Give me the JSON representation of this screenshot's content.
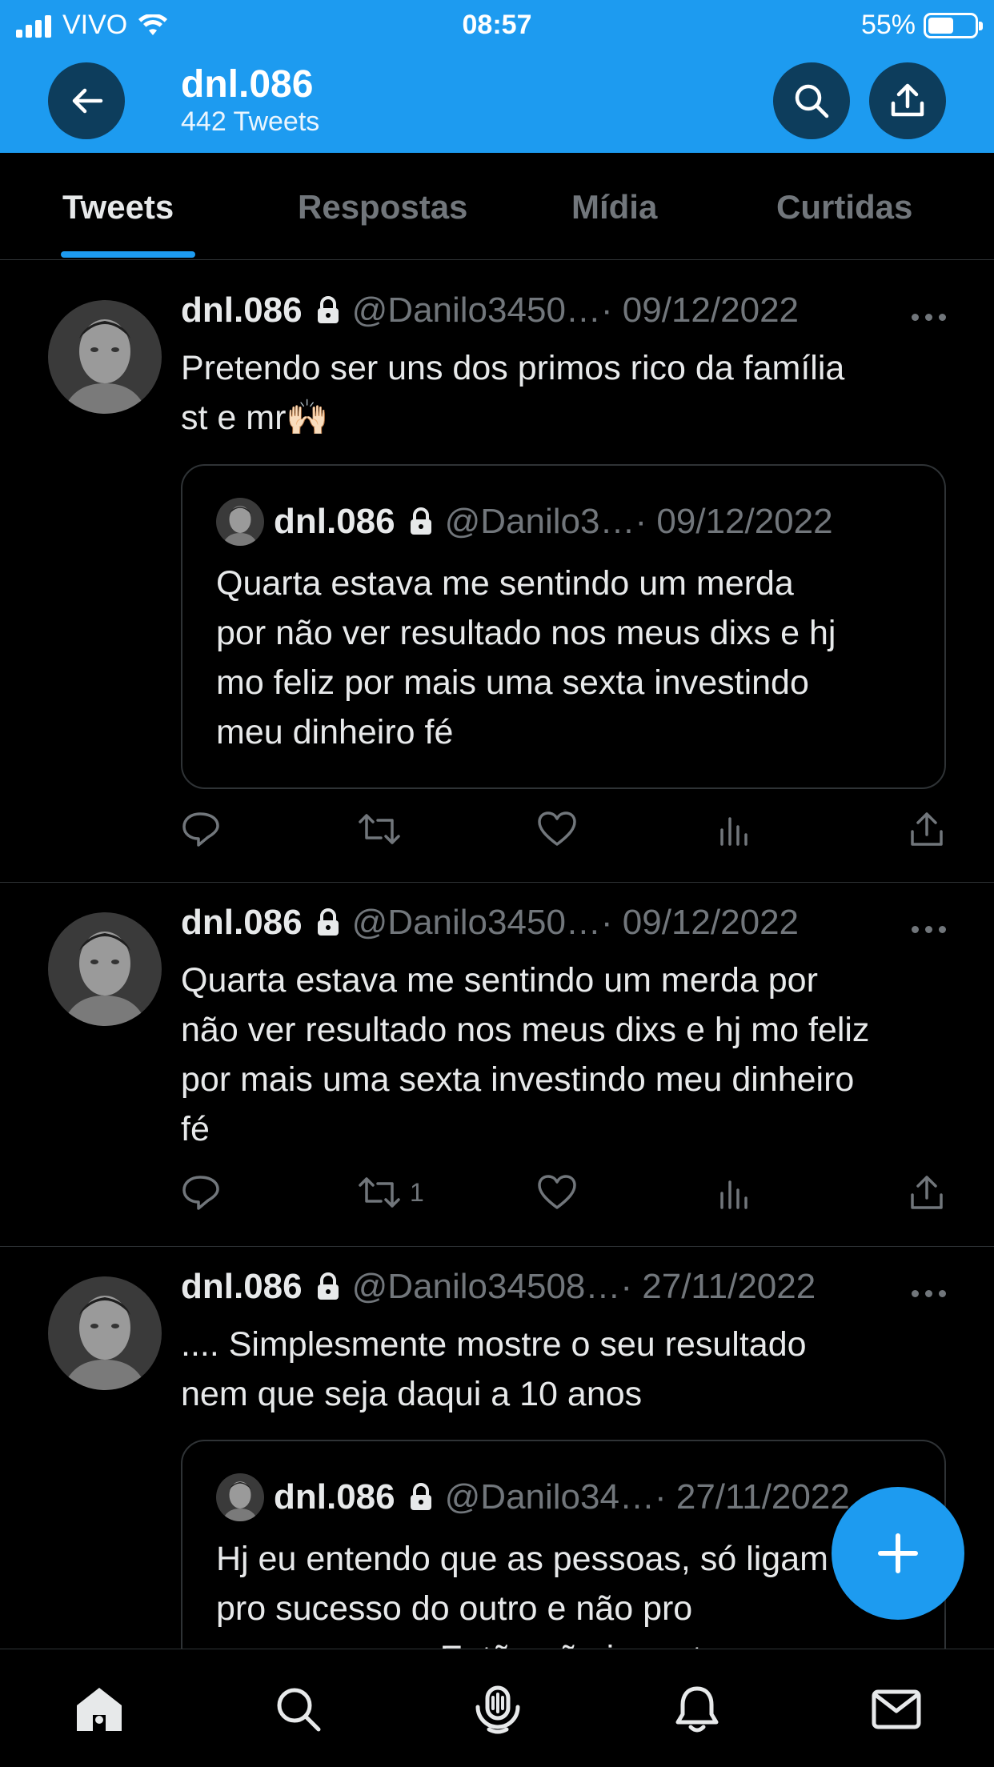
{
  "status_bar": {
    "carrier": "VIVO",
    "time": "08:57",
    "battery": "55%",
    "battery_level": 0.55
  },
  "header": {
    "title": "dnl.086",
    "subtitle": "442 Tweets"
  },
  "tabs": [
    {
      "label": "Tweets",
      "active": true
    },
    {
      "label": "Respostas",
      "active": false
    },
    {
      "label": "Mídia",
      "active": false
    },
    {
      "label": "Curtidas",
      "active": false
    }
  ],
  "tweets": [
    {
      "name": "dnl.086",
      "handle": "@Danilo3450…",
      "date": "· 09/12/2022",
      "text_lines": [
        "Pretendo ser uns dos primos rico da família",
        "st e mr🙌🏻"
      ],
      "quote": {
        "name": "dnl.086",
        "handle": "@Danilo3…",
        "date": "· 09/12/2022",
        "text_lines": [
          "Quarta estava me sentindo um merda",
          "por não ver resultado nos meus dixs e hj",
          "mo feliz por mais uma sexta investindo",
          "meu dinheiro fé"
        ]
      },
      "retweets": ""
    },
    {
      "name": "dnl.086",
      "handle": "@Danilo3450…",
      "date": "· 09/12/2022",
      "text_lines": [
        "Quarta estava me sentindo um merda por",
        "não ver resultado nos meus dixs e hj mo feliz",
        "por mais uma sexta investindo meu dinheiro",
        "fé"
      ],
      "retweets": "1"
    },
    {
      "name": "dnl.086",
      "handle": "@Danilo34508…",
      "date": "· 27/11/2022",
      "text_lines": [
        ".... Simplesmente mostre o seu resultado",
        "nem que seja daqui a 10 anos"
      ],
      "quote": {
        "name": "dnl.086",
        "handle": "@Danilo34…",
        "date": "· 27/11/2022",
        "text_lines": [
          "Hj eu entendo que as pessoas, só ligam",
          "pro sucesso do outro e não pro",
          "seu processo. Então não importa"
        ]
      }
    }
  ],
  "colors": {
    "accent": "#1d9bf0",
    "background": "#000000",
    "secondary_text": "#71767b",
    "divider": "#2f3336"
  },
  "icons": [
    "back-arrow-icon",
    "search-icon",
    "share-icon",
    "lock-icon",
    "reply-icon",
    "retweet-icon",
    "like-icon",
    "views-icon",
    "compose-plus-icon",
    "home-icon",
    "spaces-icon",
    "bell-icon",
    "mail-icon"
  ]
}
